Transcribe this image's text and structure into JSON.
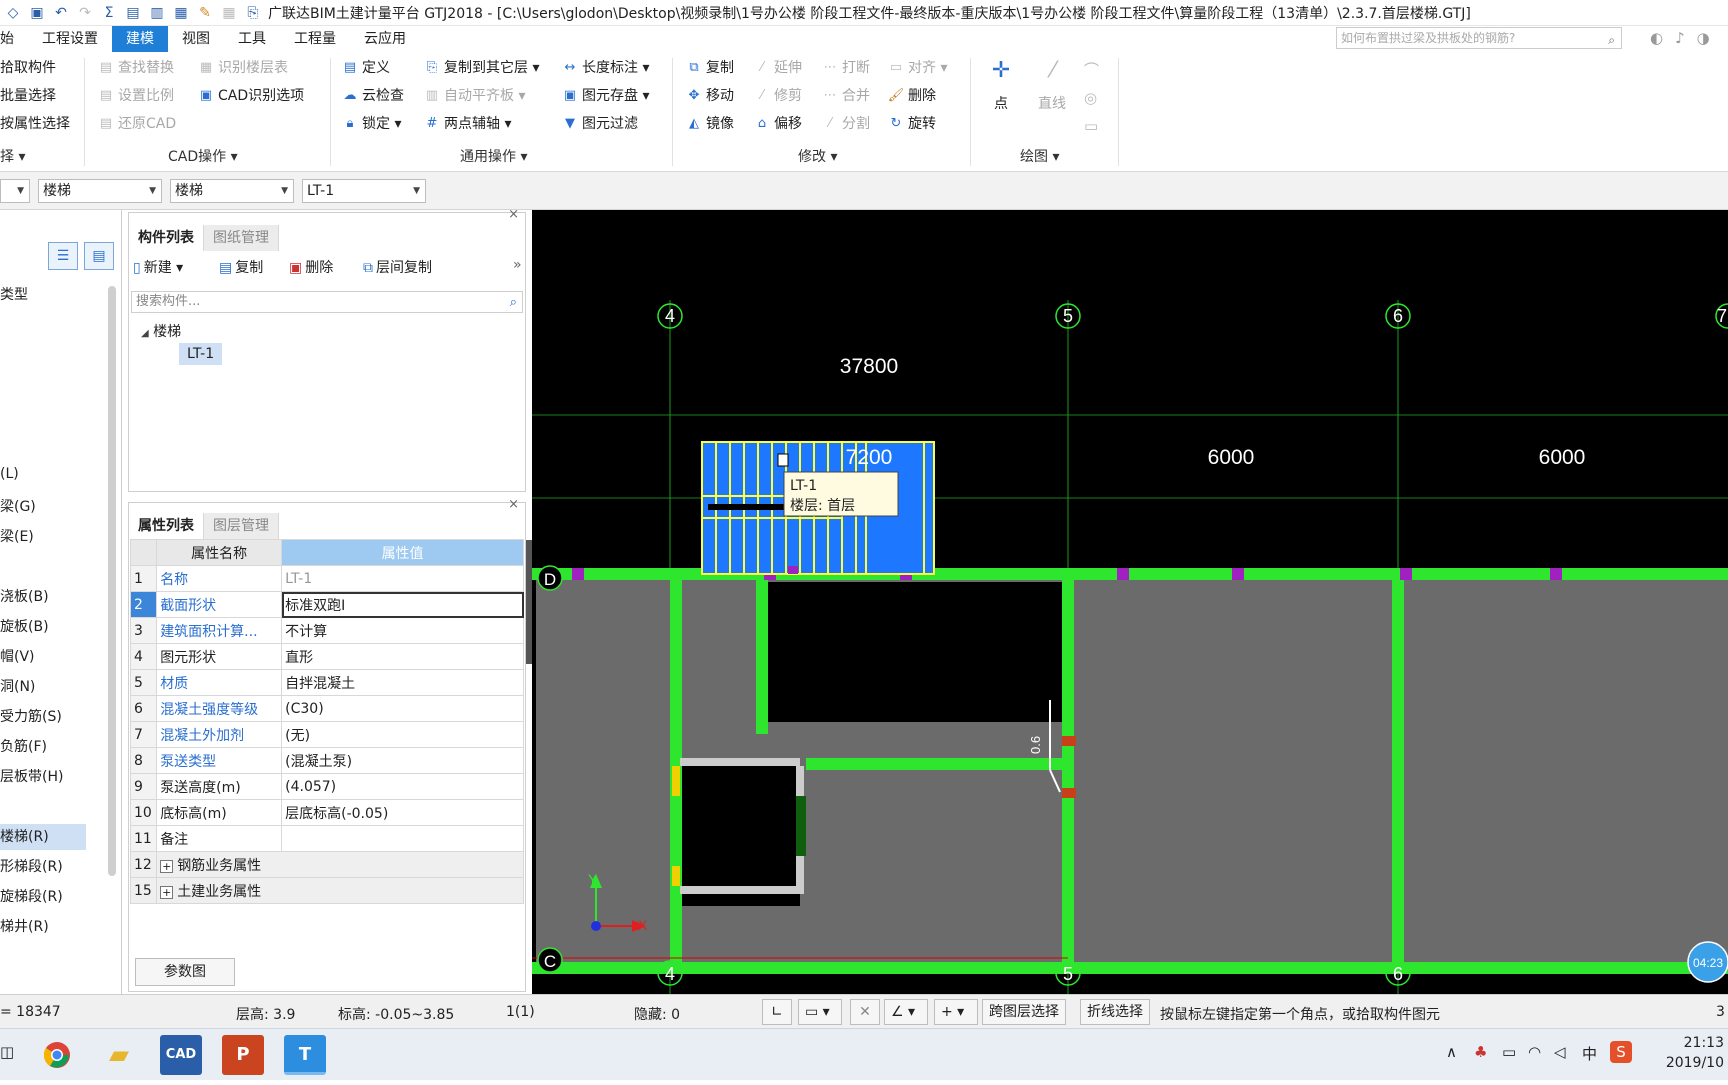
{
  "window": {
    "title": "广联达BIM土建计量平台 GTJ2018 - [C:\\Users\\glodon\\Desktop\\视频录制\\1号办公楼  阶段工程文件-最终版本-重庆版本\\1号办公楼  阶段工程文件\\算量阶段工程（13清单）\\2.3.7.首层楼梯.GTJ]"
  },
  "menu": {
    "items": [
      "始",
      "工程设置",
      "建模",
      "视图",
      "工具",
      "工程量",
      "云应用"
    ],
    "help_placeholder": "如何布置拱过梁及拱板处的钢筋?"
  },
  "ribbon": {
    "select_group": {
      "pick": "拾取构件",
      "batch": "批量选择",
      "by_attr": "按属性选择"
    },
    "cad_group": {
      "find_replace": "查找替换",
      "set_scale": "设置比例",
      "restore_cad": "还原CAD",
      "recognize_floor": "识别楼层表",
      "cad_options": "CAD识别选项",
      "label": "CAD操作"
    },
    "common_group": {
      "define": "定义",
      "cloud_check": "云检查",
      "lock": "锁定",
      "copy_to_floor": "复制到其它层",
      "auto_flat": "自动平齐板",
      "two_point_axis": "两点辅轴",
      "length_mark": "长度标注",
      "element_save": "图元存盘",
      "element_filter": "图元过滤",
      "label": "通用操作"
    },
    "modify_group": {
      "copy": "复制",
      "move": "移动",
      "mirror": "镜像",
      "extend": "延伸",
      "trim": "修剪",
      "offset": "偏移",
      "break": "打断",
      "merge": "合并",
      "split": "分割",
      "align": "对齐",
      "delete": "删除",
      "rotate": "旋转",
      "label": "修改"
    },
    "draw_group": {
      "point": "点",
      "line": "直线",
      "label": "绘图"
    }
  },
  "filters": {
    "f1": "楼梯",
    "f2": "楼梯",
    "f3": "LT-1"
  },
  "leftnav": {
    "items": [
      "类型",
      "(L)",
      "梁(G)",
      "梁(E)",
      "浇板(B)",
      "旋板(B)",
      "帽(V)",
      "洞(N)",
      "受力筋(S)",
      "负筋(F)",
      "层板带(H)",
      "楼梯(R)",
      "形梯段(R)",
      "旋梯段(R)",
      "梯井(R)"
    ]
  },
  "component_panel": {
    "tabs": [
      "构件列表",
      "图纸管理"
    ],
    "tools": {
      "new": "新建",
      "copy": "复制",
      "delete": "删除",
      "floor_copy": "层间复制"
    },
    "search_placeholder": "搜索构件...",
    "tree_root": "楼梯",
    "tree_child": "LT-1"
  },
  "property_panel": {
    "tabs": [
      "属性列表",
      "图层管理"
    ],
    "header_name": "属性名称",
    "header_value": "属性值",
    "rows": [
      {
        "idx": "1",
        "name": "名称",
        "value": "LT-1"
      },
      {
        "idx": "2",
        "name": "截面形状",
        "value": "标准双跑I"
      },
      {
        "idx": "3",
        "name": "建筑面积计算...",
        "value": "不计算"
      },
      {
        "idx": "4",
        "name": "图元形状",
        "value": "直形"
      },
      {
        "idx": "5",
        "name": "材质",
        "value": "自拌混凝土"
      },
      {
        "idx": "6",
        "name": "混凝土强度等级",
        "value": "(C30)"
      },
      {
        "idx": "7",
        "name": "混凝土外加剂",
        "value": "(无)"
      },
      {
        "idx": "8",
        "name": "泵送类型",
        "value": "(混凝土泵)"
      },
      {
        "idx": "9",
        "name": "泵送高度(m)",
        "value": "(4.057)"
      },
      {
        "idx": "10",
        "name": "底标高(m)",
        "value": "层底标高(-0.05)"
      },
      {
        "idx": "11",
        "name": "备注",
        "value": ""
      },
      {
        "idx": "12",
        "name": "钢筋业务属性",
        "value": ""
      },
      {
        "idx": "15",
        "name": "土建业务属性",
        "value": ""
      }
    ],
    "param_button": "参数图"
  },
  "canvas": {
    "axes_top": [
      "4",
      "5",
      "6",
      "7"
    ],
    "axes_bottom": [
      "4",
      "5",
      "6"
    ],
    "axes_left": [
      "D",
      "C"
    ],
    "dim_total": "37800",
    "dim_1": "7200",
    "dim_2": "6000",
    "dim_3": "6000",
    "tooltip_name": "LT-1",
    "tooltip_floor": "楼层: 首层",
    "door_label": "0.6",
    "axis_x": "X",
    "axis_y": "Y",
    "timer": "04:23"
  },
  "status": {
    "coord": "= 18347",
    "floor_height": "层高:   3.9",
    "elevation": "标高:   -0.05~3.85",
    "count": "1(1)",
    "hidden": "隐藏:  0",
    "cross_floor": "跨图层选择",
    "polyline": "折线选择",
    "hint": "按鼠标左键指定第一个角点，或拾取构件图元",
    "right_num": "3"
  },
  "taskbar": {
    "tray_lang": "中",
    "time": "21:13",
    "date": "2019/10"
  },
  "colors": {
    "accent": "#1f7fd6",
    "canvas_bg": "#000000",
    "wall_green": "#2ee62e",
    "slab_gray": "#6b6b6b",
    "stair_blue": "#1e78ff",
    "stair_outline": "#ffff33"
  }
}
